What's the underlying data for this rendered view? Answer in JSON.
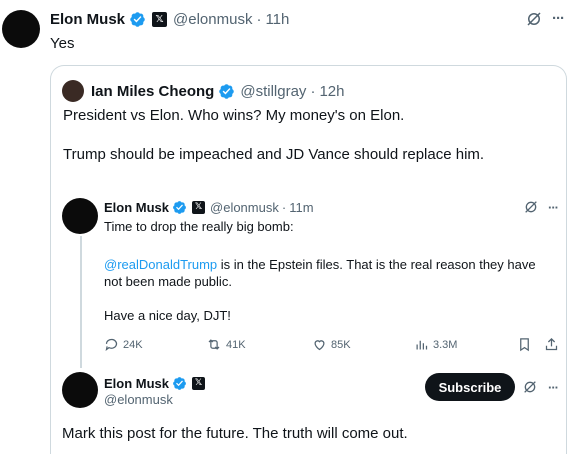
{
  "main_post": {
    "author": "Elon Musk",
    "handle": "@elonmusk",
    "time": "11h",
    "text": "Yes"
  },
  "quoted_post": {
    "author": "Ian Miles Cheong",
    "handle": "@stillgray",
    "time": "12h",
    "text_1": "President vs Elon. Who wins? My money's on Elon.",
    "text_2": "Trump should be impeached and JD Vance should replace him."
  },
  "reply_post": {
    "author": "Elon Musk",
    "handle": "@elonmusk",
    "time": "11m",
    "text_1": "Time to drop the really big bomb:",
    "mention": "@realDonaldTrump",
    "text_2": " is in the Epstein files. That is the real reason they have",
    "text_3": "not been made public.",
    "text_4": "Have a nice day, DJT!",
    "replies": "24K",
    "reposts": "41K",
    "likes": "85K",
    "views": "3.3M"
  },
  "last_post": {
    "author": "Elon Musk",
    "handle": "@elonmusk",
    "subscribe_label": "Subscribe",
    "text": "Mark this post for the future. The truth will come out."
  },
  "icons": {
    "verified": "verified-badge-icon",
    "x_badge": "x-logo-icon",
    "grok": "grok-icon",
    "more": "more-icon",
    "reply": "reply-icon",
    "repost": "repost-icon",
    "like": "like-icon",
    "views": "views-icon",
    "bookmark": "bookmark-icon",
    "share": "share-icon"
  },
  "colors": {
    "verified": "#1d9bf0",
    "link": "#1d9bf0",
    "text": "#0f1419",
    "muted": "#536471"
  },
  "x_badge_glyph": "𝕏",
  "more_glyph": "···",
  "separator": "·"
}
